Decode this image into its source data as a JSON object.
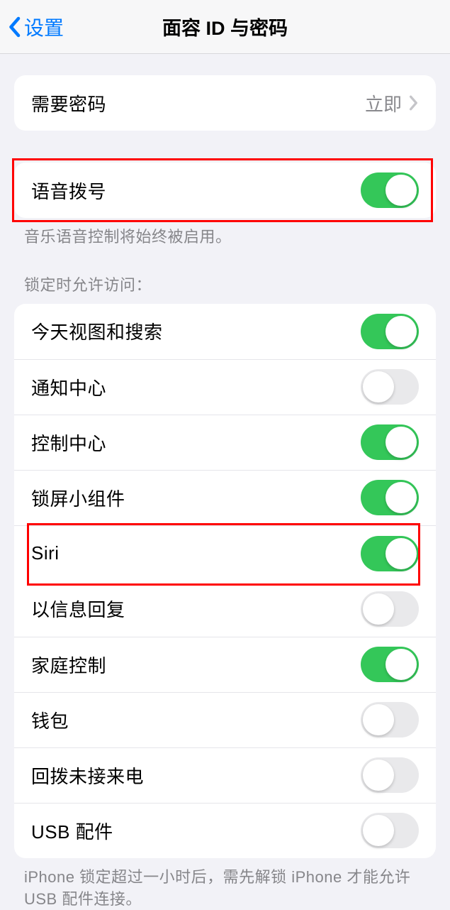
{
  "nav": {
    "back_label": "设置",
    "title": "面容 ID 与密码"
  },
  "group_passcode": {
    "require_passcode": {
      "label": "需要密码",
      "value": "立即"
    }
  },
  "group_voice": {
    "voice_dial": {
      "label": "语音拨号",
      "on": true
    },
    "footer": "音乐语音控制将始终被启用。"
  },
  "lock_access": {
    "header": "锁定时允许访问：",
    "items": [
      {
        "key": "today-view",
        "label": "今天视图和搜索",
        "on": true,
        "highlight": false
      },
      {
        "key": "notification-center",
        "label": "通知中心",
        "on": false,
        "highlight": false
      },
      {
        "key": "control-center",
        "label": "控制中心",
        "on": true,
        "highlight": false
      },
      {
        "key": "lockscreen-widgets",
        "label": "锁屏小组件",
        "on": true,
        "highlight": false
      },
      {
        "key": "siri",
        "label": "Siri",
        "on": true,
        "highlight": true
      },
      {
        "key": "reply-with-message",
        "label": "以信息回复",
        "on": false,
        "highlight": false
      },
      {
        "key": "home-control",
        "label": "家庭控制",
        "on": true,
        "highlight": false
      },
      {
        "key": "wallet",
        "label": "钱包",
        "on": false,
        "highlight": false
      },
      {
        "key": "return-missed-calls",
        "label": "回拨未接来电",
        "on": false,
        "highlight": false
      },
      {
        "key": "usb-accessories",
        "label": "USB 配件",
        "on": false,
        "highlight": false
      }
    ],
    "footer": "iPhone 锁定超过一小时后，需先解锁 iPhone 才能允许 USB 配件连接。"
  }
}
